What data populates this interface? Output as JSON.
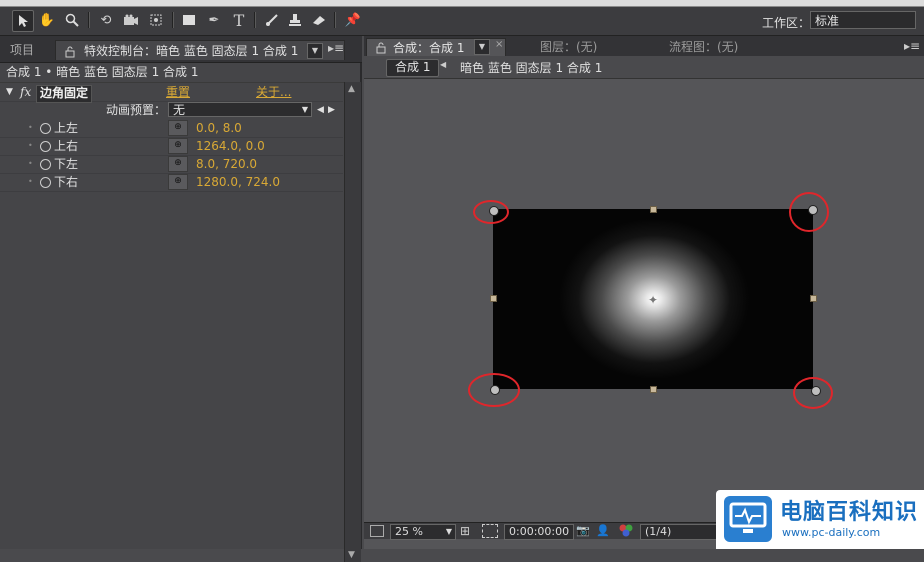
{
  "toolbar": {
    "tools": [
      "selection-tool",
      "hand-tool",
      "zoom-tool",
      "rotate-tool",
      "camera-tool",
      "pan-behind-tool",
      "rectangle-tool",
      "pen-tool",
      "text-tool",
      "brush-tool",
      "clone-stamp-tool",
      "eraser-tool",
      "puppet-pin-tool"
    ],
    "workspace_label": "工作区：",
    "workspace_value": "标准"
  },
  "left_panel": {
    "tab_project": "项目",
    "tab_effects": "特效控制台：暗色 蓝色 固态层 1 合成 1",
    "layer_path": "合成 1 • 暗色 蓝色 固态层 1 合成 1",
    "effect": {
      "name": "边角固定",
      "reset": "重置",
      "about": "关于...",
      "preset_label": "动画预置：",
      "preset_value": "无",
      "params": [
        {
          "label": "上左",
          "value": "0.0, 8.0"
        },
        {
          "label": "上右",
          "value": "1264.0, 0.0"
        },
        {
          "label": "下左",
          "value": "8.0, 720.0"
        },
        {
          "label": "下右",
          "value": "1280.0, 724.0"
        }
      ]
    }
  },
  "right_panel": {
    "tab_comp": "合成：合成 1",
    "tab_layer": "图层：(无)",
    "tab_flowchart": "流程图：(无)",
    "crumb_comp": "合成 1",
    "crumb_layer": "暗色 蓝色 固态层 1 合成 1",
    "bottom": {
      "zoom": "25 %",
      "timecode": "0:00:00:00",
      "resolution": "(1/4)"
    }
  },
  "watermark": {
    "title": "电脑百科知识",
    "url": "www.pc-daily.com"
  },
  "colors": {
    "highlight_value": "#d9a935",
    "annotation_red": "#e0262b",
    "brand_blue": "#2a7fd0"
  }
}
